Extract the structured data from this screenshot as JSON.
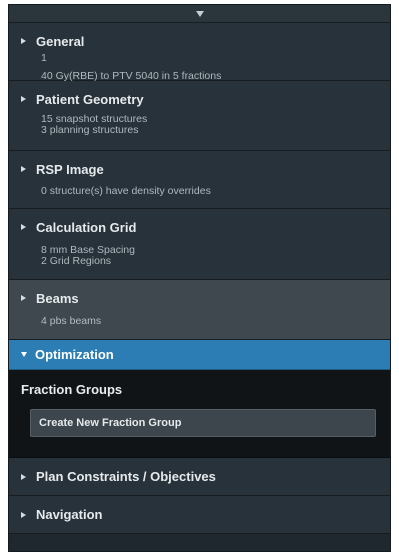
{
  "sections": {
    "general": {
      "title": "General",
      "line1": "1",
      "line2": "40 Gy(RBE) to PTV 5040 in 5 fractions"
    },
    "geometry": {
      "title": "Patient Geometry",
      "line1": "15 snapshot structures",
      "line2": "3 planning structures"
    },
    "rsp": {
      "title": "RSP Image",
      "line1": "0 structure(s) have density overrides"
    },
    "grid": {
      "title": "Calculation Grid",
      "line1": "8 mm Base Spacing",
      "line2": "2 Grid Regions"
    },
    "beams": {
      "title": "Beams",
      "line1": "4 pbs beams"
    }
  },
  "optimization": {
    "title": "Optimization",
    "fraction_groups_title": "Fraction Groups",
    "create_button": "Create New Fraction Group"
  },
  "collapsed": {
    "plan_constraints": "Plan Constraints / Objectives",
    "navigation": "Navigation"
  },
  "colors": {
    "panel_bg": "#1f282e",
    "section_bg": "#28323a",
    "selected_section_bg": "#3e484e",
    "active_header": "#2b7db4"
  },
  "icons": {
    "collapse_toggle": "triangle-down-icon",
    "section_caret": "caret-right-icon",
    "expanded_caret": "caret-down-icon"
  }
}
